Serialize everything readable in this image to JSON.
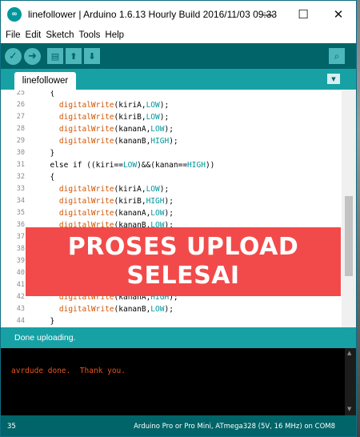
{
  "window": {
    "title": "linefollower | Arduino 1.6.13 Hourly Build 2016/11/03 09:33",
    "controls": [
      "—",
      "☐",
      "✕"
    ]
  },
  "menu": [
    "File",
    "Edit",
    "Sketch",
    "Tools",
    "Help"
  ],
  "toolbar": {
    "verify_icon": "check-icon",
    "upload_icon": "arrow-right-icon",
    "new_icon": "document-icon",
    "open_icon": "arrow-up-icon",
    "save_icon": "arrow-down-icon",
    "serial_icon": "magnifier-icon"
  },
  "tab": {
    "label": "linefollower"
  },
  "editor": {
    "lines": [
      {
        "num": "25",
        "code": "  {"
      },
      {
        "num": "26",
        "code": "    digitalWrite(kiriA,LOW);"
      },
      {
        "num": "27",
        "code": "    digitalWrite(kiriB,LOW);"
      },
      {
        "num": "28",
        "code": "    digitalWrite(kananA,LOW);"
      },
      {
        "num": "29",
        "code": "    digitalWrite(kananB,HIGH);"
      },
      {
        "num": "30",
        "code": "  }"
      },
      {
        "num": "31",
        "code": "  else if ((kiri==LOW)&&(kanan==HIGH))"
      },
      {
        "num": "32",
        "code": "  {"
      },
      {
        "num": "33",
        "code": "    digitalWrite(kiriA,LOW);"
      },
      {
        "num": "34",
        "code": "    digitalWrite(kiriB,HIGH);"
      },
      {
        "num": "35",
        "code": "    digitalWrite(kananA,LOW);"
      },
      {
        "num": "36",
        "code": "    digitalWrite(kananB,LOW);"
      },
      {
        "num": "37",
        "code": ""
      },
      {
        "num": "38",
        "code": ""
      },
      {
        "num": "39",
        "code": ""
      },
      {
        "num": "40",
        "code": ""
      },
      {
        "num": "41",
        "code": ""
      },
      {
        "num": "42",
        "code": "    digitalWrite(kananA,HIGH);"
      },
      {
        "num": "43",
        "code": "    digitalWrite(kananB,LOW);"
      },
      {
        "num": "44",
        "code": "  }"
      }
    ]
  },
  "status": {
    "message": "Done uploading."
  },
  "console": {
    "output": "avrdude done.  Thank you."
  },
  "bottom": {
    "line_number": "35",
    "board": "Arduino Pro or Pro Mini, ATmega328 (5V, 16 MHz) on COM8"
  },
  "overlay": {
    "line1": "PROSES UPLOAD",
    "line2": "SELESAI"
  },
  "colors": {
    "toolbar": "#006468",
    "tabstrip": "#17a1a5",
    "banner": "#f24a4a",
    "function": "#d35400",
    "constant": "#00979c"
  }
}
